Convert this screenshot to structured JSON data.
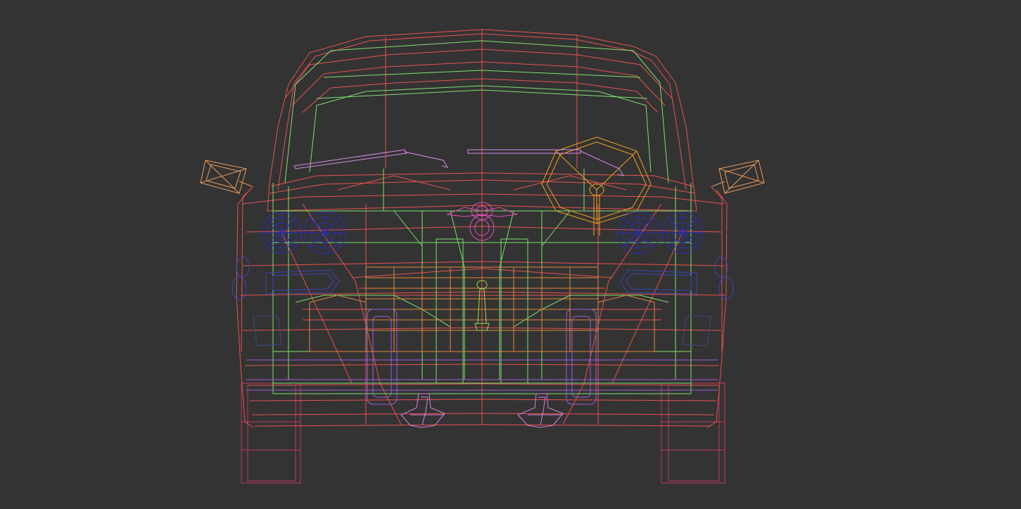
{
  "viewport": {
    "view": "Front",
    "shading": "Wireframe",
    "background": "#333333"
  },
  "model": {
    "type": "car-front-wireframe",
    "parts": [
      {
        "name": "body-shell",
        "color": "#e8524f"
      },
      {
        "name": "cabin-frame",
        "color": "#7ee06e"
      },
      {
        "name": "interior-seats",
        "color": "#e08a3c"
      },
      {
        "name": "steering-wheel",
        "color": "#f2a41f"
      },
      {
        "name": "wipers",
        "color": "#d98be8"
      },
      {
        "name": "mirrors",
        "color": "#e89a5a"
      },
      {
        "name": "headlights",
        "color": "#2a2fb0"
      },
      {
        "name": "turn-signals",
        "color": "#3a45b8"
      },
      {
        "name": "emblem",
        "color": "#e04fb8"
      },
      {
        "name": "tires",
        "color": "#c23a5e"
      },
      {
        "name": "tow-hooks",
        "color": "#d580d8"
      },
      {
        "name": "gear-shift",
        "color": "#9ae04a"
      }
    ]
  }
}
